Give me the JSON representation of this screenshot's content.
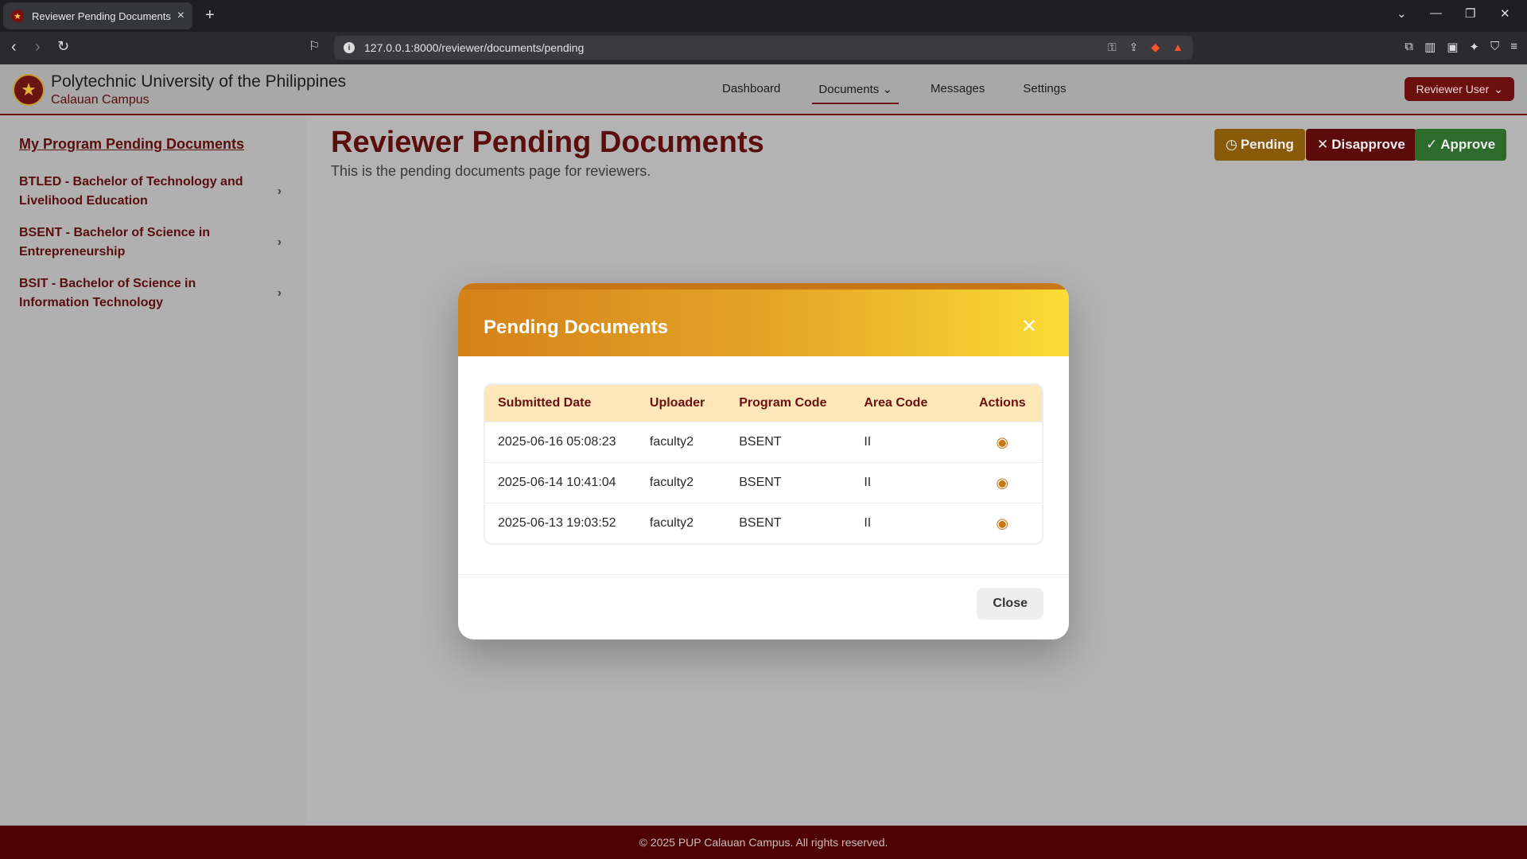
{
  "browser": {
    "tab_title": "Reviewer Pending Documents - P",
    "url": "127.0.0.1:8000/reviewer/documents/pending"
  },
  "header": {
    "university": "Polytechnic University of the Philippines",
    "campus": "Calauan Campus",
    "nav": [
      "Dashboard",
      "Documents",
      "Messages",
      "Settings"
    ],
    "user": "Reviewer User"
  },
  "sidebar": {
    "title": "My Program Pending Documents",
    "items": [
      {
        "label": "BTLED - Bachelor of Technology and Livelihood Education"
      },
      {
        "label": "BSENT - Bachelor of Science in Entrepreneurship"
      },
      {
        "label": "BSIT - Bachelor of Science in Information Technology"
      }
    ]
  },
  "main": {
    "title": "Reviewer Pending Documents",
    "subtitle": "This is the pending documents page for reviewers.",
    "buttons": {
      "pending": "Pending",
      "disapprove": "Disapprove",
      "approve": "Approve"
    }
  },
  "modal": {
    "title": "Pending Documents",
    "columns": [
      "Submitted Date",
      "Uploader",
      "Program Code",
      "Area Code",
      "Actions"
    ],
    "rows": [
      {
        "date": "2025-06-16 05:08:23",
        "uploader": "faculty2",
        "program": "BSENT",
        "area": "II"
      },
      {
        "date": "2025-06-14 10:41:04",
        "uploader": "faculty2",
        "program": "BSENT",
        "area": "II"
      },
      {
        "date": "2025-06-13 19:03:52",
        "uploader": "faculty2",
        "program": "BSENT",
        "area": "II"
      }
    ],
    "close_label": "Close"
  },
  "footer": {
    "text": "© 2025 PUP Calauan Campus. All rights reserved."
  }
}
